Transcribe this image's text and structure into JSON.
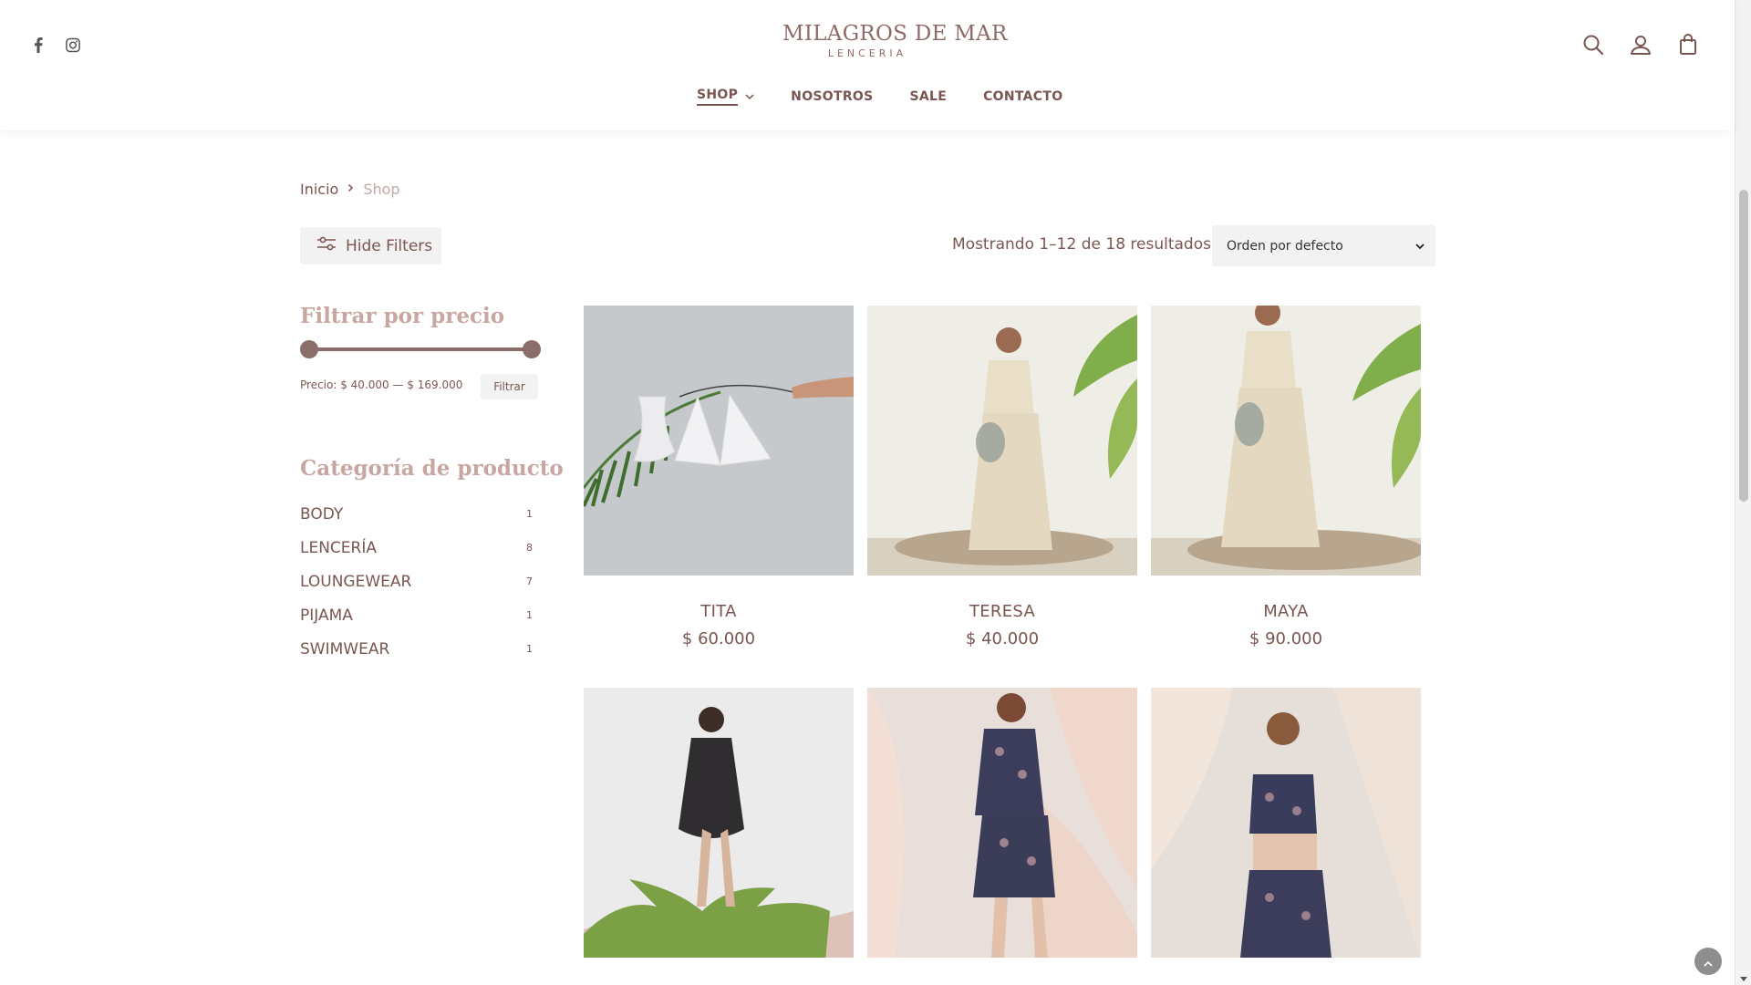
{
  "header": {
    "logo_main": "MILAGROS DE MAR",
    "logo_sub": "LENCERIA",
    "social": [
      "facebook-icon",
      "instagram-icon"
    ],
    "nav": [
      {
        "label": "SHOP",
        "active": true,
        "dropdown": true
      },
      {
        "label": "NOSOTROS"
      },
      {
        "label": "SALE"
      },
      {
        "label": "CONTACTO"
      }
    ],
    "tools": [
      "search-icon",
      "account-icon",
      "cart-icon"
    ]
  },
  "breadcrumb": {
    "home": "Inicio",
    "current": "Shop"
  },
  "toolbar": {
    "filters_label": "Hide Filters",
    "results_text": "Mostrando 1–12 de 18 resultados",
    "orderby_value": "Orden por defecto"
  },
  "sidebar": {
    "price_title": "Filtrar por precio",
    "price_label": "Precio: $ 40.000 — $ 169.000",
    "filter_button": "Filtrar",
    "category_title": "Categoría de producto",
    "categories": [
      {
        "name": "BODY",
        "count": "1"
      },
      {
        "name": "LENCERÍA",
        "count": "8"
      },
      {
        "name": "LOUNGEWEAR",
        "count": "7"
      },
      {
        "name": "PIJAMA",
        "count": "1"
      },
      {
        "name": "SWIMWEAR",
        "count": "1"
      }
    ]
  },
  "products": [
    {
      "name": "TITA",
      "price": "$ 60.000"
    },
    {
      "name": "TERESA",
      "price": "$ 40.000"
    },
    {
      "name": "MAYA",
      "price": "$ 90.000"
    },
    {
      "name": "",
      "price": ""
    },
    {
      "name": "",
      "price": ""
    },
    {
      "name": "",
      "price": ""
    }
  ],
  "colors": {
    "accent": "#7a5652",
    "heading": "#c8a7a3",
    "slider": "#8b6d69"
  }
}
